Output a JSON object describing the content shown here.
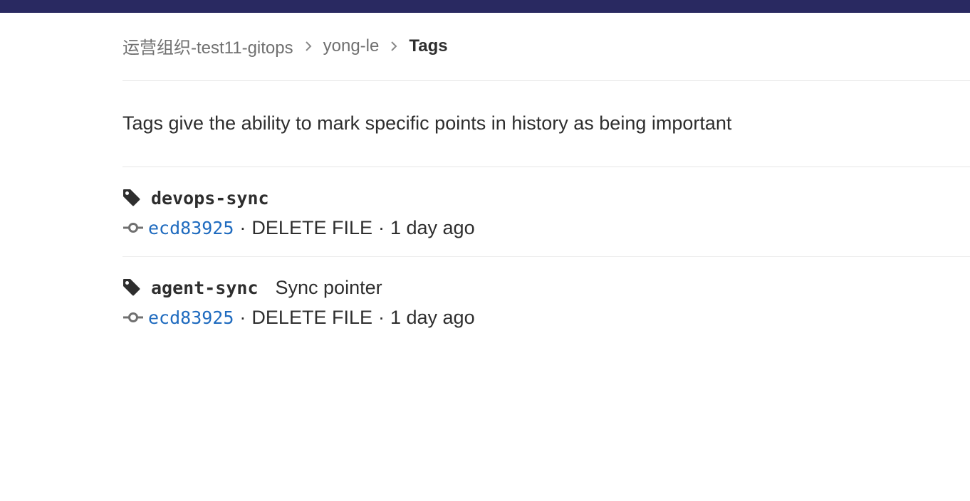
{
  "breadcrumb": {
    "items": [
      {
        "label": "运营组织-test11-gitops"
      },
      {
        "label": "yong-le"
      }
    ],
    "current": "Tags"
  },
  "description": "Tags give the ability to mark specific points in history as being important",
  "tags": [
    {
      "name": "devops-sync",
      "message": "",
      "commit_sha": "ecd83925",
      "commit_title": "DELETE FILE",
      "time": "1 day ago"
    },
    {
      "name": "agent-sync",
      "message": "Sync pointer",
      "commit_sha": "ecd83925",
      "commit_title": "DELETE FILE",
      "time": "1 day ago"
    }
  ],
  "separator": "·",
  "colors": {
    "topbar": "#292961",
    "link": "#1f6bbf",
    "text": "#2e2e2e",
    "muted": "#707070"
  },
  "icons": {
    "breadcrumb_separator": "chevron-right-icon",
    "tag": "tag-icon",
    "commit": "commit-icon"
  }
}
